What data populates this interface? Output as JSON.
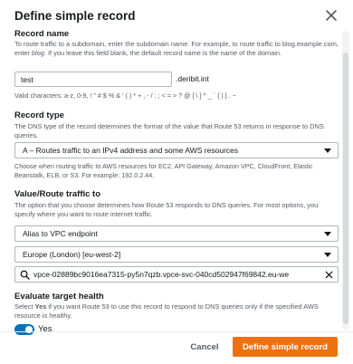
{
  "dialog": {
    "title": "Define simple record"
  },
  "record_name": {
    "label": "Record name",
    "description_pre": "To route traffic to a subdomain, enter the subdomain name. For example, to route traffic to blog.example.com, enter ",
    "description_em": "blog",
    "description_post": ". If you leave this field blank, the default record name is the name of the domain.",
    "value": "test",
    "suffix": ".deribit.int",
    "hint": "Valid characters: a-z, 0-9, ! \" # $ % & ' ( ) * + , - / : ; < = > ? @ [ \\ ] ^ _ ` { | } . ~"
  },
  "record_type": {
    "label": "Record type",
    "description": "The DNS type of the record determines the format of the value that Route 53 returns in response to DNS queries.",
    "selected": "A – Routes traffic to an IPv4 address and some AWS resources",
    "hint": "Choose when routing traffic to AWS resources for EC2, API Gateway, Amazon VPC, CloudFront, Elastic Beanstalk, ELB, or S3. For example: 192.0.2.44."
  },
  "value_route": {
    "label": "Value/Route traffic to",
    "description": "The option that you choose determines how Route 53 responds to DNS queries. For most options, you specify where you want to route internet traffic.",
    "endpoint_type": "Alias to VPC endpoint",
    "region": "Europe (London) [eu-west-2]",
    "endpoint_value": "vpce-02889bc9016ea7315-py5n7qzb.vpce-svc-040cd502947f69842.eu-we"
  },
  "health": {
    "label": "Evaluate target health",
    "description_pre": "Select ",
    "description_em": "Yes",
    "description_post": " if you want Route 53 to use this record to respond to DNS queries only if the specified AWS resource is healthy.",
    "toggle_label": "Yes",
    "enabled": true
  },
  "footer": {
    "cancel_label": "Cancel",
    "submit_label": "Define simple record"
  },
  "colors": {
    "primary": "#ec7211",
    "toggle_on": "#0073bb",
    "text": "#16191f",
    "muted": "#545b64"
  }
}
